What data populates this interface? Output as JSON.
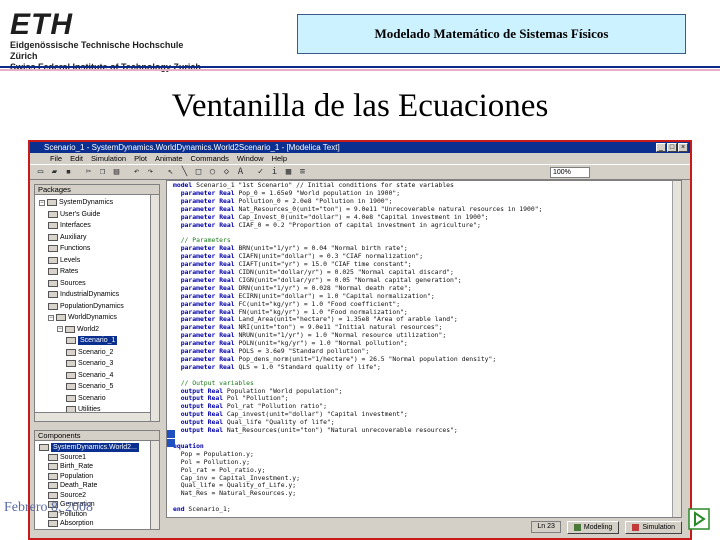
{
  "header": {
    "logo_text": "ETH",
    "logo_line1": "Eidgenössische Technische Hochschule Zürich",
    "logo_line2": "Swiss Federal Institute of Technology Zurich",
    "course_title": "Modelado Matemático de Sistemas Físicos"
  },
  "slide": {
    "title": "Ventanilla de las Ecuaciones",
    "footer_date": "Febrero 8, 2008"
  },
  "app": {
    "window_title": "Scenario_1 - SystemDynamics.WorldDynamics.World2Scenario_1 - [Modelica Text]",
    "menu": [
      "File",
      "Edit",
      "Simulation",
      "Plot",
      "Animate",
      "Commands",
      "Window",
      "Help"
    ],
    "zoom": "100%",
    "packages_panel_title": "Packages",
    "components_panel_title": "Components",
    "package_tree": [
      {
        "label": "SystemDynamics",
        "depth": 0,
        "expanded": true
      },
      {
        "label": "User's Guide",
        "depth": 1
      },
      {
        "label": "Interfaces",
        "depth": 1
      },
      {
        "label": "Auxiliary",
        "depth": 1
      },
      {
        "label": "Functions",
        "depth": 1
      },
      {
        "label": "Levels",
        "depth": 1
      },
      {
        "label": "Rates",
        "depth": 1
      },
      {
        "label": "Sources",
        "depth": 1
      },
      {
        "label": "IndustrialDynamics",
        "depth": 1
      },
      {
        "label": "PopulationDynamics",
        "depth": 1
      },
      {
        "label": "WorldDynamics",
        "depth": 1,
        "expanded": true
      },
      {
        "label": "World2",
        "depth": 2,
        "expanded": true
      },
      {
        "label": "Scenario_1",
        "depth": 3,
        "selected": true
      },
      {
        "label": "Scenario_2",
        "depth": 3
      },
      {
        "label": "Scenario_3",
        "depth": 3
      },
      {
        "label": "Scenario_4",
        "depth": 3
      },
      {
        "label": "Scenario_5",
        "depth": 3
      },
      {
        "label": "Scenario",
        "depth": 3
      },
      {
        "label": "Utilities",
        "depth": 3
      }
    ],
    "component_tree": [
      {
        "label": "SystemDynamics.World2...",
        "depth": 0,
        "selected": true
      },
      {
        "label": "Source1",
        "depth": 1
      },
      {
        "label": "Birth_Rate",
        "depth": 1
      },
      {
        "label": "Population",
        "depth": 1
      },
      {
        "label": "Death_Rate",
        "depth": 1
      },
      {
        "label": "Source2",
        "depth": 1
      },
      {
        "label": "Generation",
        "depth": 1
      },
      {
        "label": "Pollution",
        "depth": 1
      },
      {
        "label": "Absorption",
        "depth": 1
      }
    ],
    "status_position": "Ln 23",
    "mode_modeling": "Modeling",
    "mode_simulation": "Simulation"
  },
  "code": [
    "model Scenario_1 \"1st Scenario\" // Initial conditions for state variables",
    "  parameter Real Pop_0 = 1.65e9 \"World population in 1900\";",
    "  parameter Real Pollution_0 = 2.0e8 \"Pollution in 1900\";",
    "  parameter Real Nat_Resources_0(unit=\"ton\") = 9.0e11 \"Unrecoverable natural resources in 1900\";",
    "  parameter Real Cap_Invest_0(unit=\"dollar\") = 4.0e8 \"Capital investment in 1900\";",
    "  parameter Real CIAF_0 = 0.2 \"Proportion of capital investment in agriculture\";",
    "",
    "  // Parameters",
    "  parameter Real BRN(unit=\"1/yr\") = 0.04 \"Normal birth rate\";",
    "  parameter Real CIAFN(unit=\"dollar\") = 0.3 \"CIAF normalization\";",
    "  parameter Real CIAFT(unit=\"yr\") = 15.0 \"CIAF time constant\";",
    "  parameter Real CIDN(unit=\"dollar/yr\") = 0.025 \"Normal capital discard\";",
    "  parameter Real CIGN(unit=\"dollar/yr\") = 0.05 \"Normal capital generation\";",
    "  parameter Real DRN(unit=\"1/yr\") = 0.028 \"Normal death rate\";",
    "  parameter Real ECIRN(unit=\"dollar\") = 1.0 \"Capital normalization\";",
    "  parameter Real FC(unit=\"kg/yr\") = 1.0 \"Food coefficient\";",
    "  parameter Real FN(unit=\"kg/yr\") = 1.0 \"Food normalization\";",
    "  parameter Real Land_Area(unit=\"hectare\") = 1.35e8 \"Area of arable land\";",
    "  parameter Real NRI(unit=\"ton\") = 9.0e11 \"Initial natural resources\";",
    "  parameter Real NRUN(unit=\"1/yr\") = 1.0 \"Normal resource utilization\";",
    "  parameter Real POLN(unit=\"kg/yr\") = 1.0 \"Normal pollution\";",
    "  parameter Real POLS = 3.6e9 \"Standard pollution\";",
    "  parameter Real Pop_dens_norm(unit=\"1/hectare\") = 26.5 \"Normal population density\";",
    "  parameter Real QLS = 1.0 \"Standard quality of life\";",
    "",
    "  // Output variables",
    "  output Real Population \"World population\";",
    "  output Real Pol \"Pollution\";",
    "  output Real Pol_rat \"Pollution ratio\";",
    "  output Real Cap_invest(unit=\"dollar\") \"Capital investment\";",
    "  output Real Qual_life \"Quality of life\";",
    "  output Real Nat_Resources(unit=\"ton\") \"Natural unrecoverable resources\";",
    "",
    "equation",
    "  Pop = Population.y;",
    "  Pol = Pollution.y;",
    "  Pol_rat = Pol_ratio.y;",
    "  Cap_inv = Capital_Investment.y;",
    "  Qual_life = Quality_of_Life.y;",
    "  Nat_Res = Natural_Resources.y;",
    "",
    "end Scenario_1;"
  ]
}
